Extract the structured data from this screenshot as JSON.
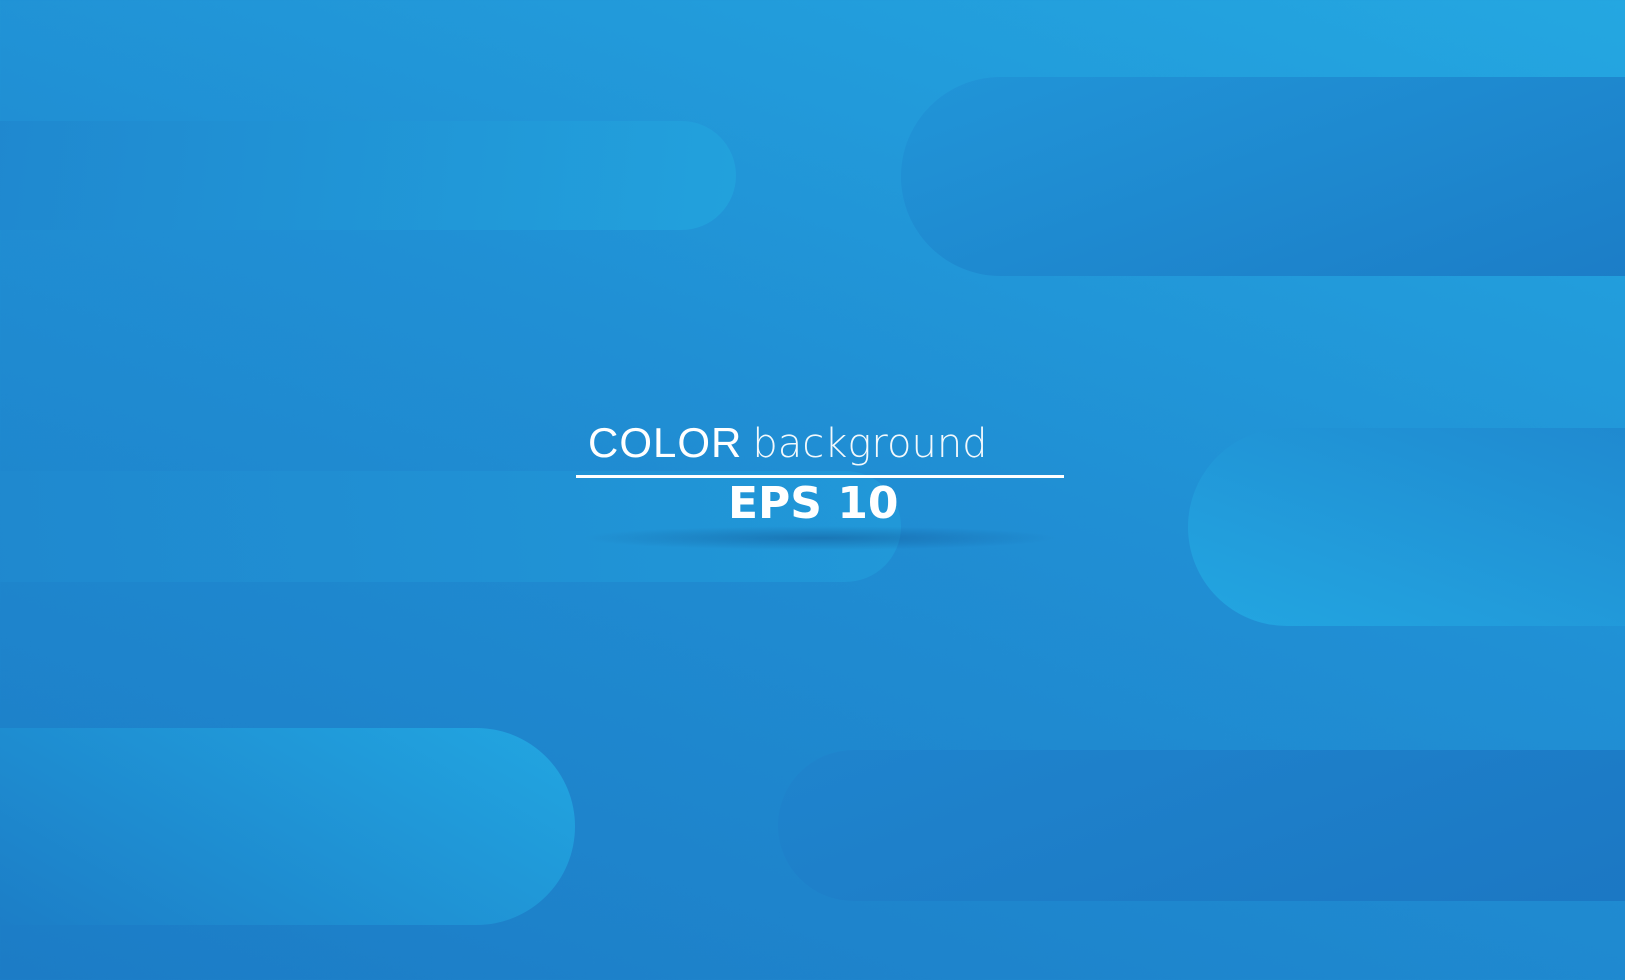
{
  "headline": {
    "strong": "COLOR",
    "light": "background"
  },
  "subheadline": "EPS 10",
  "colors": {
    "background_light": "#24a7e1",
    "background_dark": "#1c7cc6",
    "text": "#ffffff"
  }
}
